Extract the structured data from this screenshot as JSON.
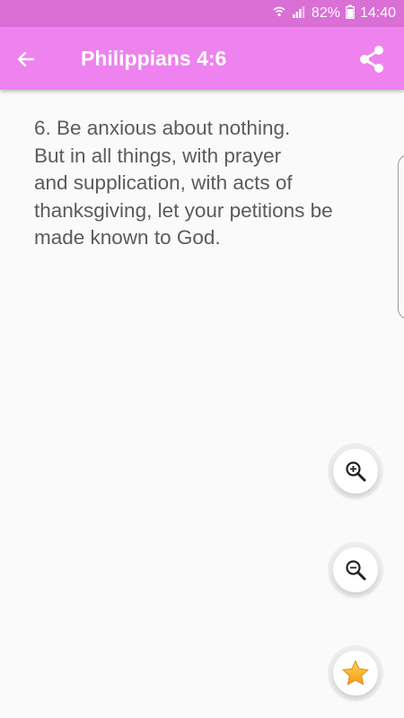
{
  "status_bar": {
    "battery_percent": "82%",
    "time": "14:40",
    "icons": [
      "wifi-icon",
      "signal-icon",
      "battery-icon"
    ]
  },
  "app_bar": {
    "title": "Philippians 4:6",
    "back_icon": "arrow-left-icon",
    "share_icon": "share-icon"
  },
  "verse": {
    "text": "6. Be anxious about nothing.\nBut in all things, with prayer\nand supplication, with acts of\nthanksgiving, let your petitions be\nmade known to God."
  },
  "fabs": [
    {
      "name": "zoom-in-button",
      "icon": "zoom-in-icon"
    },
    {
      "name": "zoom-out-button",
      "icon": "zoom-out-icon"
    },
    {
      "name": "favorite-button",
      "icon": "star-icon"
    }
  ],
  "colors": {
    "status_bar": "#da6fd6",
    "app_bar": "#ee82ee",
    "text": "#5b5b5b",
    "background": "#fafafa",
    "star": "#f7a928"
  }
}
